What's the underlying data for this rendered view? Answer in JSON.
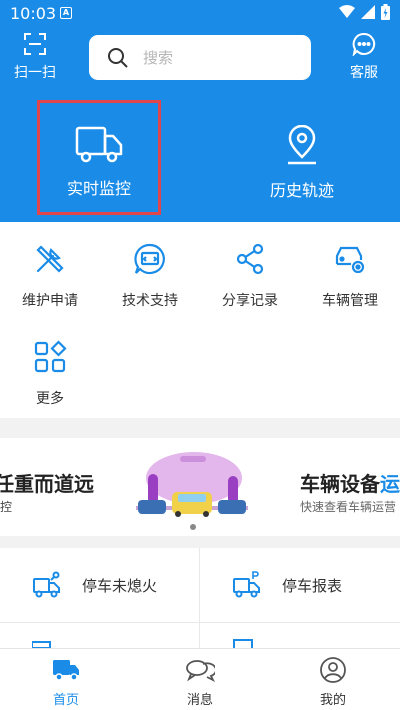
{
  "status_bar": {
    "time": "10:03",
    "notification_badge": "A"
  },
  "top_bar": {
    "scan_label": "扫一扫",
    "search_placeholder": "搜索",
    "service_label": "客服"
  },
  "hero": {
    "realtime_label": "实时监控",
    "history_label": "历史轨迹"
  },
  "grid": {
    "items": [
      {
        "label": "维护申请",
        "icon": "tools-icon"
      },
      {
        "label": "技术支持",
        "icon": "support-chat-icon"
      },
      {
        "label": "分享记录",
        "icon": "share-icon"
      },
      {
        "label": "车辆管理",
        "icon": "car-settings-icon"
      },
      {
        "label": "更多",
        "icon": "more-grid-icon"
      }
    ]
  },
  "banner": {
    "left_title": "任重而道远",
    "left_subtitle": "控",
    "right_title": "车辆设备",
    "right_title_highlight": "运",
    "right_subtitle": "快速查看车辆运营"
  },
  "actions": [
    {
      "label": "停车未熄火",
      "icon": "truck-key-icon"
    },
    {
      "label": "停车报表",
      "icon": "truck-parking-icon"
    }
  ],
  "tabbar": {
    "home_label": "首页",
    "messages_label": "消息",
    "mine_label": "我的"
  },
  "colors": {
    "primary": "#1a8ce8",
    "highlight_border": "#e0464c",
    "background": "#f2f2f2"
  }
}
